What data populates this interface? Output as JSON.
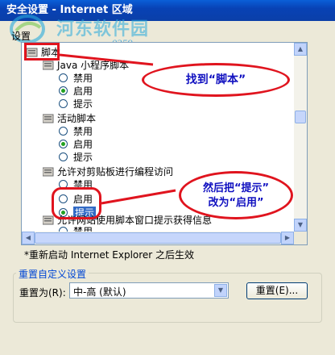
{
  "window": {
    "title": "安全设置 - Internet 区域"
  },
  "watermark": {
    "site_name": "河东软件园",
    "url": "www.pc0359.cn"
  },
  "settings_label": "设置",
  "tree": {
    "scripts_header": "脚本",
    "java_applets": "Java 小程序脚本",
    "java_options": [
      "禁用",
      "启用",
      "提示"
    ],
    "active_scripting": "活动脚本",
    "active_options": [
      "禁用",
      "启用",
      "提示"
    ],
    "clipboard": "允许对剪贴板进行编程访问",
    "clipboard_options": [
      "禁用",
      "启用",
      "提示"
    ],
    "status_bar": "允许网站使用脚本窗口提示获得信息",
    "status_first_option": "禁用"
  },
  "restart_note": "*重新启动 Internet Explorer 之后生效",
  "reset_group": {
    "title": "重置自定义设置",
    "reset_to_label": "重置为(R):",
    "level_value": "中-高 (默认)",
    "reset_button": "重置(E)..."
  },
  "annotations": {
    "find_script": "找到“脚本”",
    "change_line1": "然后把“提示”",
    "change_line2": "改为“启用”"
  },
  "colors": {
    "annotation_red": "#e0141e",
    "annotation_text": "#1010c0",
    "selection": "#316ac5"
  }
}
